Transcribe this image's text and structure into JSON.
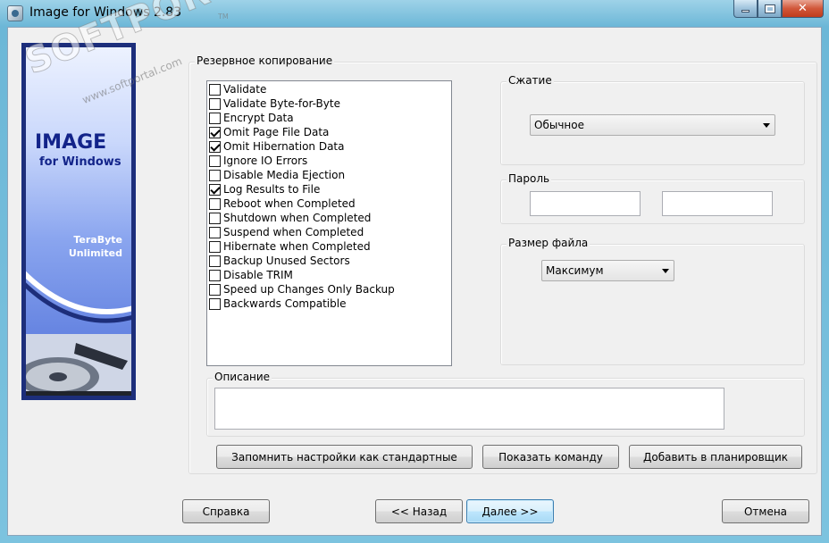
{
  "window": {
    "title": "Image for Windows 2.83",
    "close_glyph": "✕"
  },
  "banner": {
    "title": "IMAGE",
    "subtitle": "for Windows",
    "company_line1": "TeraByte",
    "company_line2": "Unlimited"
  },
  "backup": {
    "group_label": "Резервное копирование",
    "options": [
      {
        "label": "Validate",
        "checked": false
      },
      {
        "label": "Validate Byte-for-Byte",
        "checked": false
      },
      {
        "label": "Encrypt Data",
        "checked": false
      },
      {
        "label": "Omit Page File Data",
        "checked": true
      },
      {
        "label": "Omit Hibernation Data",
        "checked": true
      },
      {
        "label": "Ignore IO Errors",
        "checked": false
      },
      {
        "label": "Disable Media Ejection",
        "checked": false
      },
      {
        "label": "Log Results to File",
        "checked": true
      },
      {
        "label": "Reboot when Completed",
        "checked": false
      },
      {
        "label": "Shutdown when Completed",
        "checked": false
      },
      {
        "label": "Suspend when Completed",
        "checked": false
      },
      {
        "label": "Hibernate when Completed",
        "checked": false
      },
      {
        "label": "Backup Unused Sectors",
        "checked": false
      },
      {
        "label": "Disable TRIM",
        "checked": false
      },
      {
        "label": "Speed up Changes Only Backup",
        "checked": false
      },
      {
        "label": "Backwards Compatible",
        "checked": false
      }
    ]
  },
  "compression": {
    "label": "Сжатие",
    "value": "Обычное"
  },
  "password": {
    "label": "Пароль",
    "value1": "",
    "value2": ""
  },
  "file_size": {
    "label": "Размер файла",
    "value": "Максимум"
  },
  "description": {
    "label": "Описание",
    "value": ""
  },
  "actions": {
    "save_defaults": "Запомнить настройки как стандартные",
    "show_command": "Показать команду",
    "add_scheduler": "Добавить в планировщик"
  },
  "footer": {
    "help": "Справка",
    "back": "<< Назад",
    "next": "Далее >>",
    "cancel": "Отмена"
  },
  "watermark": {
    "main": "SOFTPORTAL",
    "sub": "www.softportal.com",
    "tm": "TM"
  }
}
